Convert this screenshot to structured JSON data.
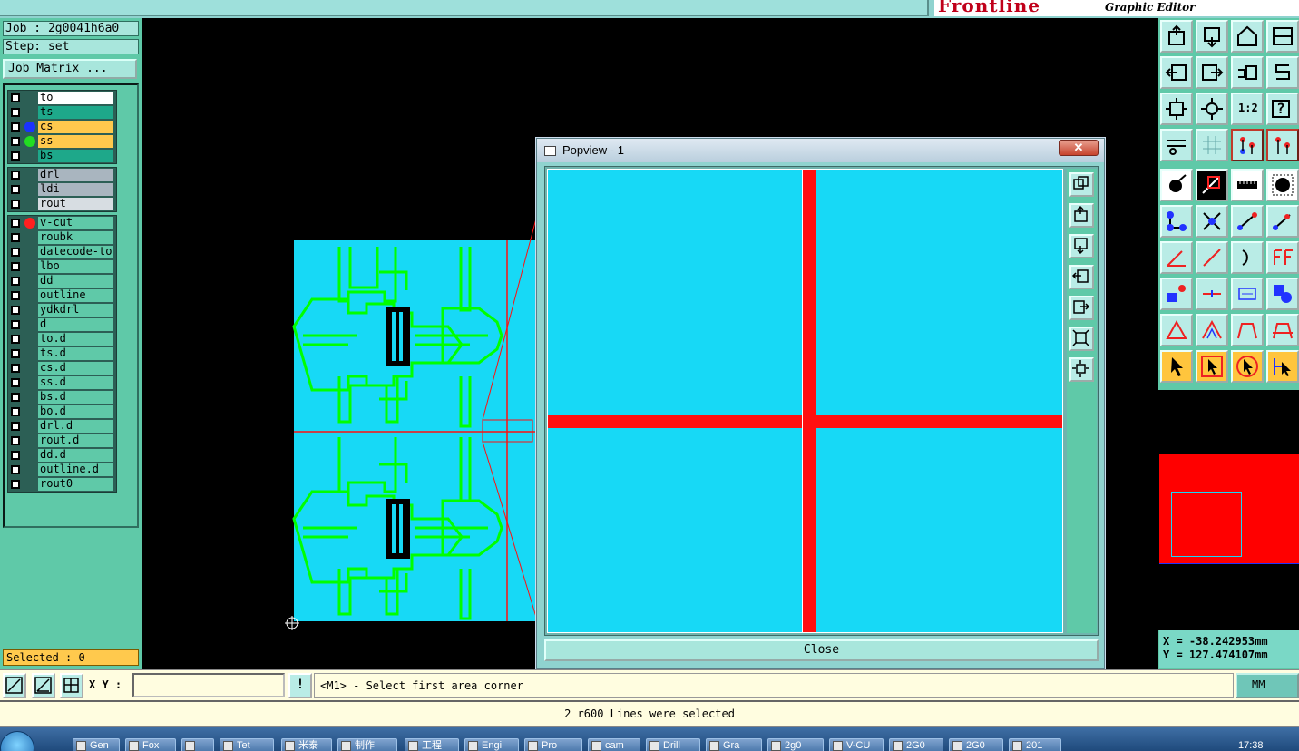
{
  "brand": {
    "logo": "Frontline",
    "subtitle": "Graphic Editor"
  },
  "info": {
    "job": "Job : 2g0041h6a0",
    "step": "Step: set",
    "job_matrix": "Job Matrix ..."
  },
  "layers": {
    "board": [
      {
        "name": "to",
        "color": "#ffffff",
        "dot": ""
      },
      {
        "name": "ts",
        "color": "#1ea88a",
        "dot": ""
      },
      {
        "name": "cs",
        "color": "#ffc94d",
        "dot": "#1a33ff"
      },
      {
        "name": "ss",
        "color": "#ffc94d",
        "dot": "#22dd22"
      },
      {
        "name": "bs",
        "color": "#1ea88a",
        "dot": ""
      }
    ],
    "drill": [
      {
        "name": "drl",
        "color": "#a9b5bf"
      },
      {
        "name": "ldi",
        "color": "#a9b5bf"
      },
      {
        "name": "rout",
        "color": "#d7dde2"
      }
    ],
    "misc": [
      {
        "name": "v-cut",
        "color": "#5fc9a8",
        "dot": "#ff2020"
      },
      {
        "name": "roubk"
      },
      {
        "name": "datecode-to"
      },
      {
        "name": "lbo"
      },
      {
        "name": "dd"
      },
      {
        "name": "outline"
      },
      {
        "name": "ydkdrl"
      },
      {
        "name": "d"
      },
      {
        "name": "to.d"
      },
      {
        "name": "ts.d"
      },
      {
        "name": "cs.d"
      },
      {
        "name": "ss.d"
      },
      {
        "name": "bs.d"
      },
      {
        "name": "bo.d"
      },
      {
        "name": "drl.d"
      },
      {
        "name": "rout.d"
      },
      {
        "name": "dd.d"
      },
      {
        "name": "outline.d"
      },
      {
        "name": "rout0"
      }
    ]
  },
  "selected": "Selected : 0",
  "popview": {
    "title": "Popview - 1",
    "close_x": "✕",
    "close_button": "Close"
  },
  "coords": {
    "x": "X = -38.242953mm",
    "y": "Y = 127.474107mm"
  },
  "command": {
    "xy_label": "X Y :",
    "xy_value": "",
    "bang": "!",
    "prompt": "<M1> - Select first area corner",
    "units": "MM"
  },
  "status": "2 r600 Lines were selected",
  "right_tools": {
    "zoom_ratio_label": "1:2",
    "help_label": "?"
  },
  "taskbar": {
    "items": [
      "Gen",
      "Fox",
      "",
      "Tet",
      "米泰",
      "制作",
      "工程",
      "Engi",
      "Pro",
      "cam",
      "Drill",
      "Gra",
      "2g0",
      "V-CU",
      "2G0",
      "2G0",
      "201"
    ],
    "clock": "17:38"
  },
  "colors": {
    "board": "#17d9f6",
    "trace": "#00ff00",
    "vcut": "#ff1010",
    "panel": "#5fc9a8"
  }
}
